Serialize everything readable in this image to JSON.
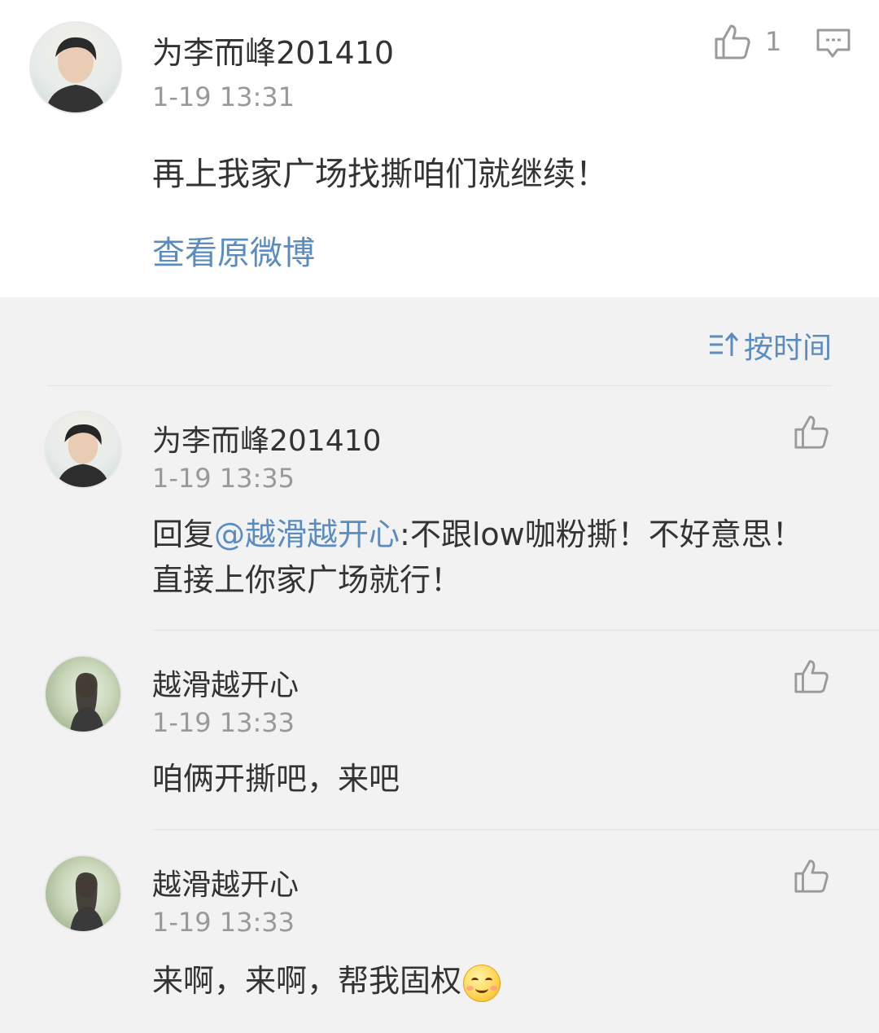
{
  "post": {
    "author": "为李而峰201410",
    "time": "1-19 13:31",
    "like_count": "1",
    "content": "再上我家广场找撕咱们就继续！",
    "view_original": "查看原微博"
  },
  "sort": {
    "label": "按时间"
  },
  "comments": [
    {
      "author": "为李而峰201410",
      "time": "1-19 13:35",
      "reply_prefix": "回复",
      "mention": "@越滑越开心",
      "text": ":不跟low咖粉撕！不好意思！直接上你家广场就行！"
    },
    {
      "author": "越滑越开心",
      "time": "1-19 13:33",
      "text": "咱俩开撕吧，来吧"
    },
    {
      "author": "越滑越开心",
      "time": "1-19 13:33",
      "text": "来啊，来啊，帮我固权"
    }
  ],
  "colors": {
    "link": "#5b8cbf",
    "muted": "#999999",
    "text": "#333333"
  },
  "icons": {
    "like": "thumbs-up-icon",
    "comment": "comment-icon",
    "sort": "sort-icon",
    "emoji": "smile-emoji-icon"
  }
}
